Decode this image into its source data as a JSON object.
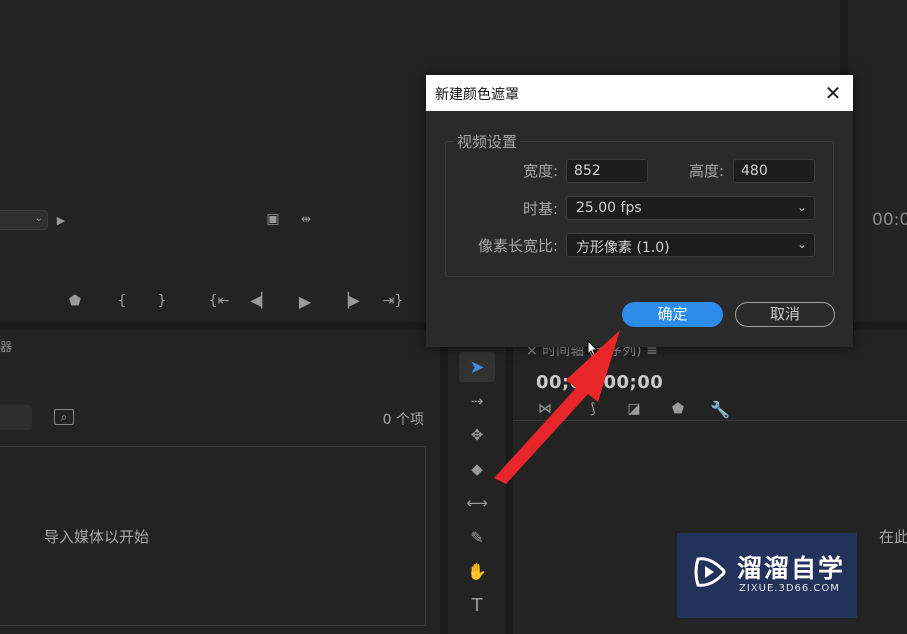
{
  "source_monitor": {
    "transport_icons": [
      "marker-icon",
      "mark-in-icon",
      "mark-out-icon",
      "go-to-in-icon",
      "step-back-icon",
      "play-icon",
      "step-forward-icon",
      "go-to-out-icon"
    ]
  },
  "program_monitor": {
    "timecode": "00:0"
  },
  "project": {
    "tab_fragment": "器",
    "item_count": "0 个项",
    "import_hint": "导入媒体以开始"
  },
  "timeline": {
    "tab_label": "× 时间轴 (无序列) ≡",
    "timecode": "00;00;00;00",
    "drop_hint": "在此"
  },
  "dialog": {
    "title": "新建颜色遮罩",
    "group_label": "视频设置",
    "width_label": "宽度:",
    "width_value": "852",
    "height_label": "高度:",
    "height_value": "480",
    "timebase_label": "时基:",
    "timebase_value": "25.00 fps",
    "pixel_aspect_label": "像素长宽比:",
    "pixel_aspect_value": "方形像素 (1.0)",
    "ok_label": "确定",
    "cancel_label": "取消"
  },
  "watermark": {
    "title": "溜溜自学",
    "subtitle": "ZIXUE.3D66.COM"
  },
  "colors": {
    "accent": "#2d8ceb",
    "arrow": "#e8262a",
    "panel": "#232323"
  }
}
